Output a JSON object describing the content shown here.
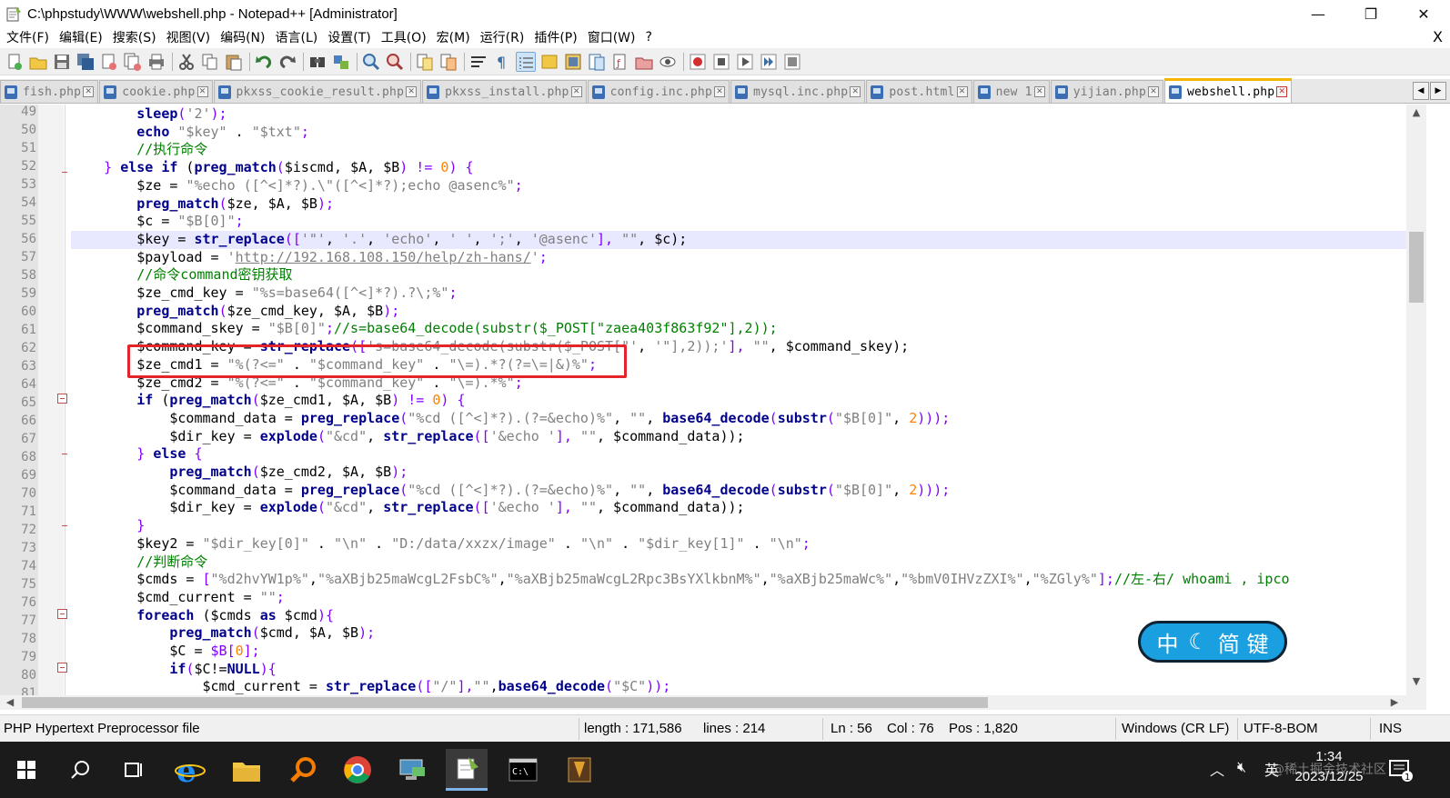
{
  "window": {
    "title": "C:\\phpstudy\\WWW\\webshell.php - Notepad++ [Administrator]",
    "minimize": "—",
    "maximize": "❐",
    "close": "✕"
  },
  "menu": {
    "items": [
      "文件(F)",
      "编辑(E)",
      "搜索(S)",
      "视图(V)",
      "编码(N)",
      "语言(L)",
      "设置(T)",
      "工具(O)",
      "宏(M)",
      "运行(R)",
      "插件(P)",
      "窗口(W)",
      "?"
    ],
    "close_doc": "X"
  },
  "tabs": [
    {
      "label": "fish.php",
      "active": false
    },
    {
      "label": "cookie.php",
      "active": false
    },
    {
      "label": "pkxss_cookie_result.php",
      "active": false
    },
    {
      "label": "pkxss_install.php",
      "active": false
    },
    {
      "label": "config.inc.php",
      "active": false
    },
    {
      "label": "mysql.inc.php",
      "active": false
    },
    {
      "label": "post.html",
      "active": false
    },
    {
      "label": "new 1",
      "active": false
    },
    {
      "label": "yijian.php",
      "active": false
    },
    {
      "label": "webshell.php",
      "active": true
    }
  ],
  "editor": {
    "line_numbers": [
      "49",
      "50",
      "51",
      "52",
      "53",
      "54",
      "55",
      "56",
      "57",
      "58",
      "59",
      "60",
      "61",
      "62",
      "63",
      "64",
      "65",
      "66",
      "67",
      "68",
      "69",
      "70",
      "71",
      "72",
      "73",
      "74",
      "75",
      "76",
      "77",
      "78",
      "79",
      "80",
      "81"
    ],
    "current_line_index": 7
  },
  "ime": {
    "mode": "中",
    "moon": "☾",
    "label": "简 键"
  },
  "status": {
    "filetype": "PHP Hypertext Preprocessor file",
    "length": "length : 171,586",
    "lines": "lines : 214",
    "ln": "Ln : 56",
    "col": "Col : 76",
    "pos": "Pos : 1,820",
    "eol": "Windows (CR LF)",
    "encoding": "UTF-8-BOM",
    "mode": "INS"
  },
  "taskbar": {
    "ime_lang": "英",
    "time": "1:34",
    "date": "2023/12/25",
    "notification_count": "1"
  },
  "watermark": "@稀土掘金技术社区",
  "colors": {
    "highlight_box": "#e3242b",
    "keyword": "#00008b",
    "comment": "#008000",
    "number": "#ff8000",
    "string": "#808080",
    "active_tab_accent": "#f4b400",
    "ime_bg": "#1a9fe0"
  }
}
